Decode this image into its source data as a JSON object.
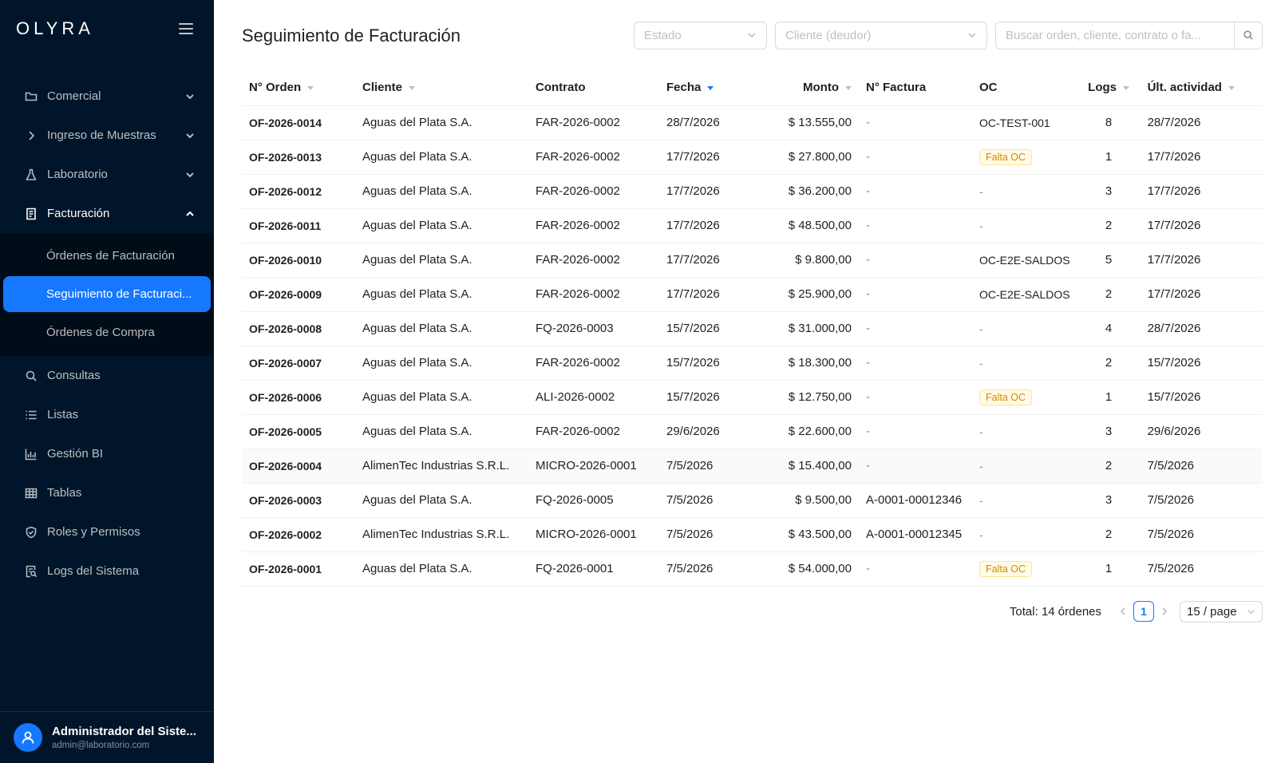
{
  "brand": "OLYRA",
  "sidebar": {
    "items": [
      {
        "label": "Comercial"
      },
      {
        "label": "Ingreso de Muestras"
      },
      {
        "label": "Laboratorio"
      },
      {
        "label": "Facturación"
      },
      {
        "label": "Consultas"
      },
      {
        "label": "Listas"
      },
      {
        "label": "Gestión BI"
      },
      {
        "label": "Tablas"
      },
      {
        "label": "Roles y Permisos"
      },
      {
        "label": "Logs del Sistema"
      }
    ],
    "submenu": [
      {
        "label": "Órdenes de Facturación"
      },
      {
        "label": "Seguimiento de Facturaci..."
      },
      {
        "label": "Órdenes de Compra"
      }
    ]
  },
  "user": {
    "name": "Administrador del Siste...",
    "email": "admin@laboratorio.com"
  },
  "page": {
    "title": "Seguimiento de Facturación"
  },
  "filters": {
    "estado_placeholder": "Estado",
    "cliente_placeholder": "Cliente (deudor)",
    "search_placeholder": "Buscar orden, cliente, contrato o fa..."
  },
  "table": {
    "headers": {
      "orden": "N° Orden",
      "cliente": "Cliente",
      "contrato": "Contrato",
      "fecha": "Fecha",
      "monto": "Monto",
      "factura": "N° Factura",
      "oc": "OC",
      "logs": "Logs",
      "actividad": "Últ. actividad"
    },
    "rows": [
      {
        "orden": "OF-2026-0014",
        "cliente": "Aguas del Plata S.A.",
        "contrato": "FAR-2026-0002",
        "fecha": "28/7/2026",
        "monto": "$ 13.555,00",
        "factura": "-",
        "oc": "OC-TEST-001",
        "logs": "8",
        "actividad": "28/7/2026"
      },
      {
        "orden": "OF-2026-0013",
        "cliente": "Aguas del Plata S.A.",
        "contrato": "FAR-2026-0002",
        "fecha": "17/7/2026",
        "monto": "$ 27.800,00",
        "factura": "-",
        "oc": "Falta OC",
        "logs": "1",
        "actividad": "17/7/2026"
      },
      {
        "orden": "OF-2026-0012",
        "cliente": "Aguas del Plata S.A.",
        "contrato": "FAR-2026-0002",
        "fecha": "17/7/2026",
        "monto": "$ 36.200,00",
        "factura": "-",
        "oc": "-",
        "logs": "3",
        "actividad": "17/7/2026"
      },
      {
        "orden": "OF-2026-0011",
        "cliente": "Aguas del Plata S.A.",
        "contrato": "FAR-2026-0002",
        "fecha": "17/7/2026",
        "monto": "$ 48.500,00",
        "factura": "-",
        "oc": "-",
        "logs": "2",
        "actividad": "17/7/2026"
      },
      {
        "orden": "OF-2026-0010",
        "cliente": "Aguas del Plata S.A.",
        "contrato": "FAR-2026-0002",
        "fecha": "17/7/2026",
        "monto": "$ 9.800,00",
        "factura": "-",
        "oc": "OC-E2E-SALDOS",
        "logs": "5",
        "actividad": "17/7/2026"
      },
      {
        "orden": "OF-2026-0009",
        "cliente": "Aguas del Plata S.A.",
        "contrato": "FAR-2026-0002",
        "fecha": "17/7/2026",
        "monto": "$ 25.900,00",
        "factura": "-",
        "oc": "OC-E2E-SALDOS",
        "logs": "2",
        "actividad": "17/7/2026"
      },
      {
        "orden": "OF-2026-0008",
        "cliente": "Aguas del Plata S.A.",
        "contrato": "FQ-2026-0003",
        "fecha": "15/7/2026",
        "monto": "$ 31.000,00",
        "factura": "-",
        "oc": "-",
        "logs": "4",
        "actividad": "28/7/2026"
      },
      {
        "orden": "OF-2026-0007",
        "cliente": "Aguas del Plata S.A.",
        "contrato": "FAR-2026-0002",
        "fecha": "15/7/2026",
        "monto": "$ 18.300,00",
        "factura": "-",
        "oc": "-",
        "logs": "2",
        "actividad": "15/7/2026"
      },
      {
        "orden": "OF-2026-0006",
        "cliente": "Aguas del Plata S.A.",
        "contrato": "ALI-2026-0002",
        "fecha": "15/7/2026",
        "monto": "$ 12.750,00",
        "factura": "-",
        "oc": "Falta OC",
        "logs": "1",
        "actividad": "15/7/2026"
      },
      {
        "orden": "OF-2026-0005",
        "cliente": "Aguas del Plata S.A.",
        "contrato": "FAR-2026-0002",
        "fecha": "29/6/2026",
        "monto": "$ 22.600,00",
        "factura": "-",
        "oc": "-",
        "logs": "3",
        "actividad": "29/6/2026"
      },
      {
        "orden": "OF-2026-0004",
        "cliente": "AlimenTec Industrias S.R.L.",
        "contrato": "MICRO-2026-0001",
        "fecha": "7/5/2026",
        "monto": "$ 15.400,00",
        "factura": "-",
        "oc": "-",
        "logs": "2",
        "actividad": "7/5/2026"
      },
      {
        "orden": "OF-2026-0003",
        "cliente": "Aguas del Plata S.A.",
        "contrato": "FQ-2026-0005",
        "fecha": "7/5/2026",
        "monto": "$ 9.500,00",
        "factura": "A-0001-00012346",
        "oc": "-",
        "logs": "3",
        "actividad": "7/5/2026"
      },
      {
        "orden": "OF-2026-0002",
        "cliente": "AlimenTec Industrias S.R.L.",
        "contrato": "MICRO-2026-0001",
        "fecha": "7/5/2026",
        "monto": "$ 43.500,00",
        "factura": "A-0001-00012345",
        "oc": "-",
        "logs": "2",
        "actividad": "7/5/2026"
      },
      {
        "orden": "OF-2026-0001",
        "cliente": "Aguas del Plata S.A.",
        "contrato": "FQ-2026-0001",
        "fecha": "7/5/2026",
        "monto": "$ 54.000,00",
        "factura": "-",
        "oc": "Falta OC",
        "logs": "1",
        "actividad": "7/5/2026"
      }
    ]
  },
  "pagination": {
    "total": "Total: 14 órdenes",
    "current": "1",
    "page_size": "15 / page"
  }
}
